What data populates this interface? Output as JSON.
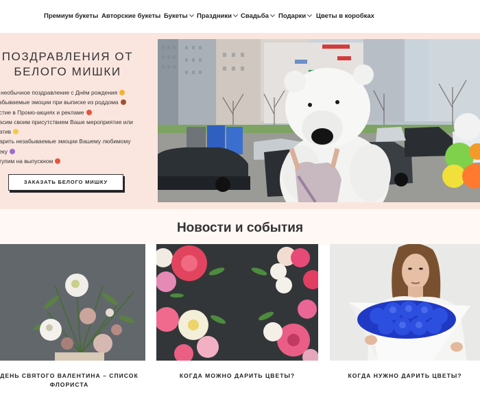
{
  "nav": {
    "items": [
      {
        "label": "Премиум букеты",
        "has_dropdown": false
      },
      {
        "label": "Авторские букеты",
        "has_dropdown": false
      },
      {
        "label": "Букеты",
        "has_dropdown": true
      },
      {
        "label": "Праздники",
        "has_dropdown": true
      },
      {
        "label": "Свадьба",
        "has_dropdown": true
      },
      {
        "label": "Подарки",
        "has_dropdown": true
      },
      {
        "label": "Цветы в коробках",
        "has_dropdown": false
      }
    ]
  },
  "hero": {
    "title_line1": "Поздравления от",
    "title_line2": "Белого Мишки",
    "bullets": [
      "е необычное поздравление с Днём рождения",
      "забываемые эмоции при выписке из роддома",
      "астие в Промо-акциях и рекламе",
      "расим своим присутствием Ваше мероприятие или",
      "ратив",
      "дарить незабываемые эмоции Вашему любимому",
      "веку",
      "ступим на выпускном"
    ],
    "button_label": "Заказать белого мишку",
    "image_alt": "Белый медведь"
  },
  "news": {
    "title": "Новости и события",
    "cards": [
      {
        "caption_line1": "День святого Валентина – список",
        "caption_line2": "флориста"
      },
      {
        "caption_line1": "Когда можно дарить цветы?",
        "caption_line2": ""
      },
      {
        "caption_line1": "Когда нужно дарить цветы?",
        "caption_line2": ""
      }
    ]
  },
  "colors": {
    "hero_bg": "#fae6df",
    "accent_text": "#222222"
  }
}
